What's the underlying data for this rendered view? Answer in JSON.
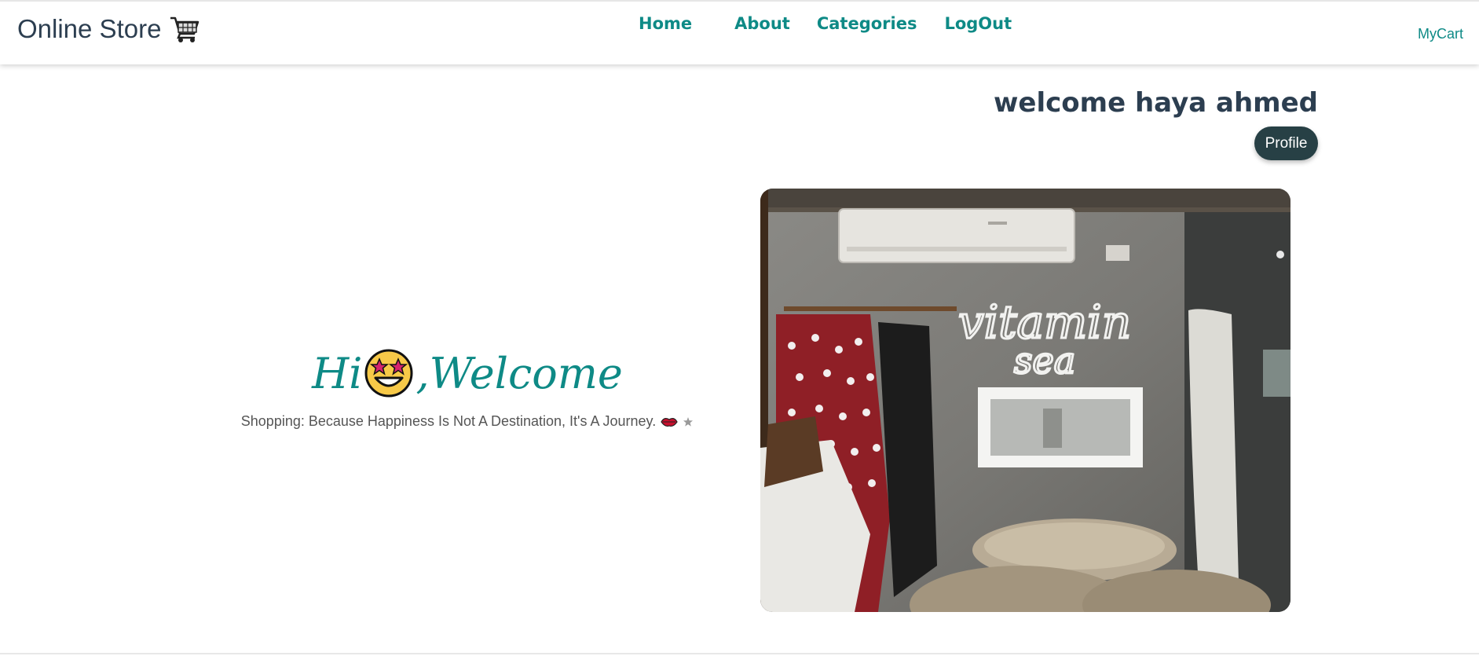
{
  "header": {
    "brand": "Online Store",
    "brand_icon": "shopping-cart-icon",
    "nav": {
      "home": "Home",
      "about": "About",
      "categories": "Categories",
      "logout": "LogOut"
    },
    "mycart": "MyCart",
    "accent_color": "#0e8a86"
  },
  "user": {
    "welcome": "welcome haya ahmed",
    "profile_button": "Profile"
  },
  "hero": {
    "title_hi": "Hi",
    "title_emoji": "star-struck-face-icon",
    "title_welcome": ",Welcome",
    "subtitle": "Shopping: Because Happiness Is Not A Destination, It's A Journey."
  },
  "photo": {
    "neon_line1": "vitamin",
    "neon_line2": "sea"
  }
}
